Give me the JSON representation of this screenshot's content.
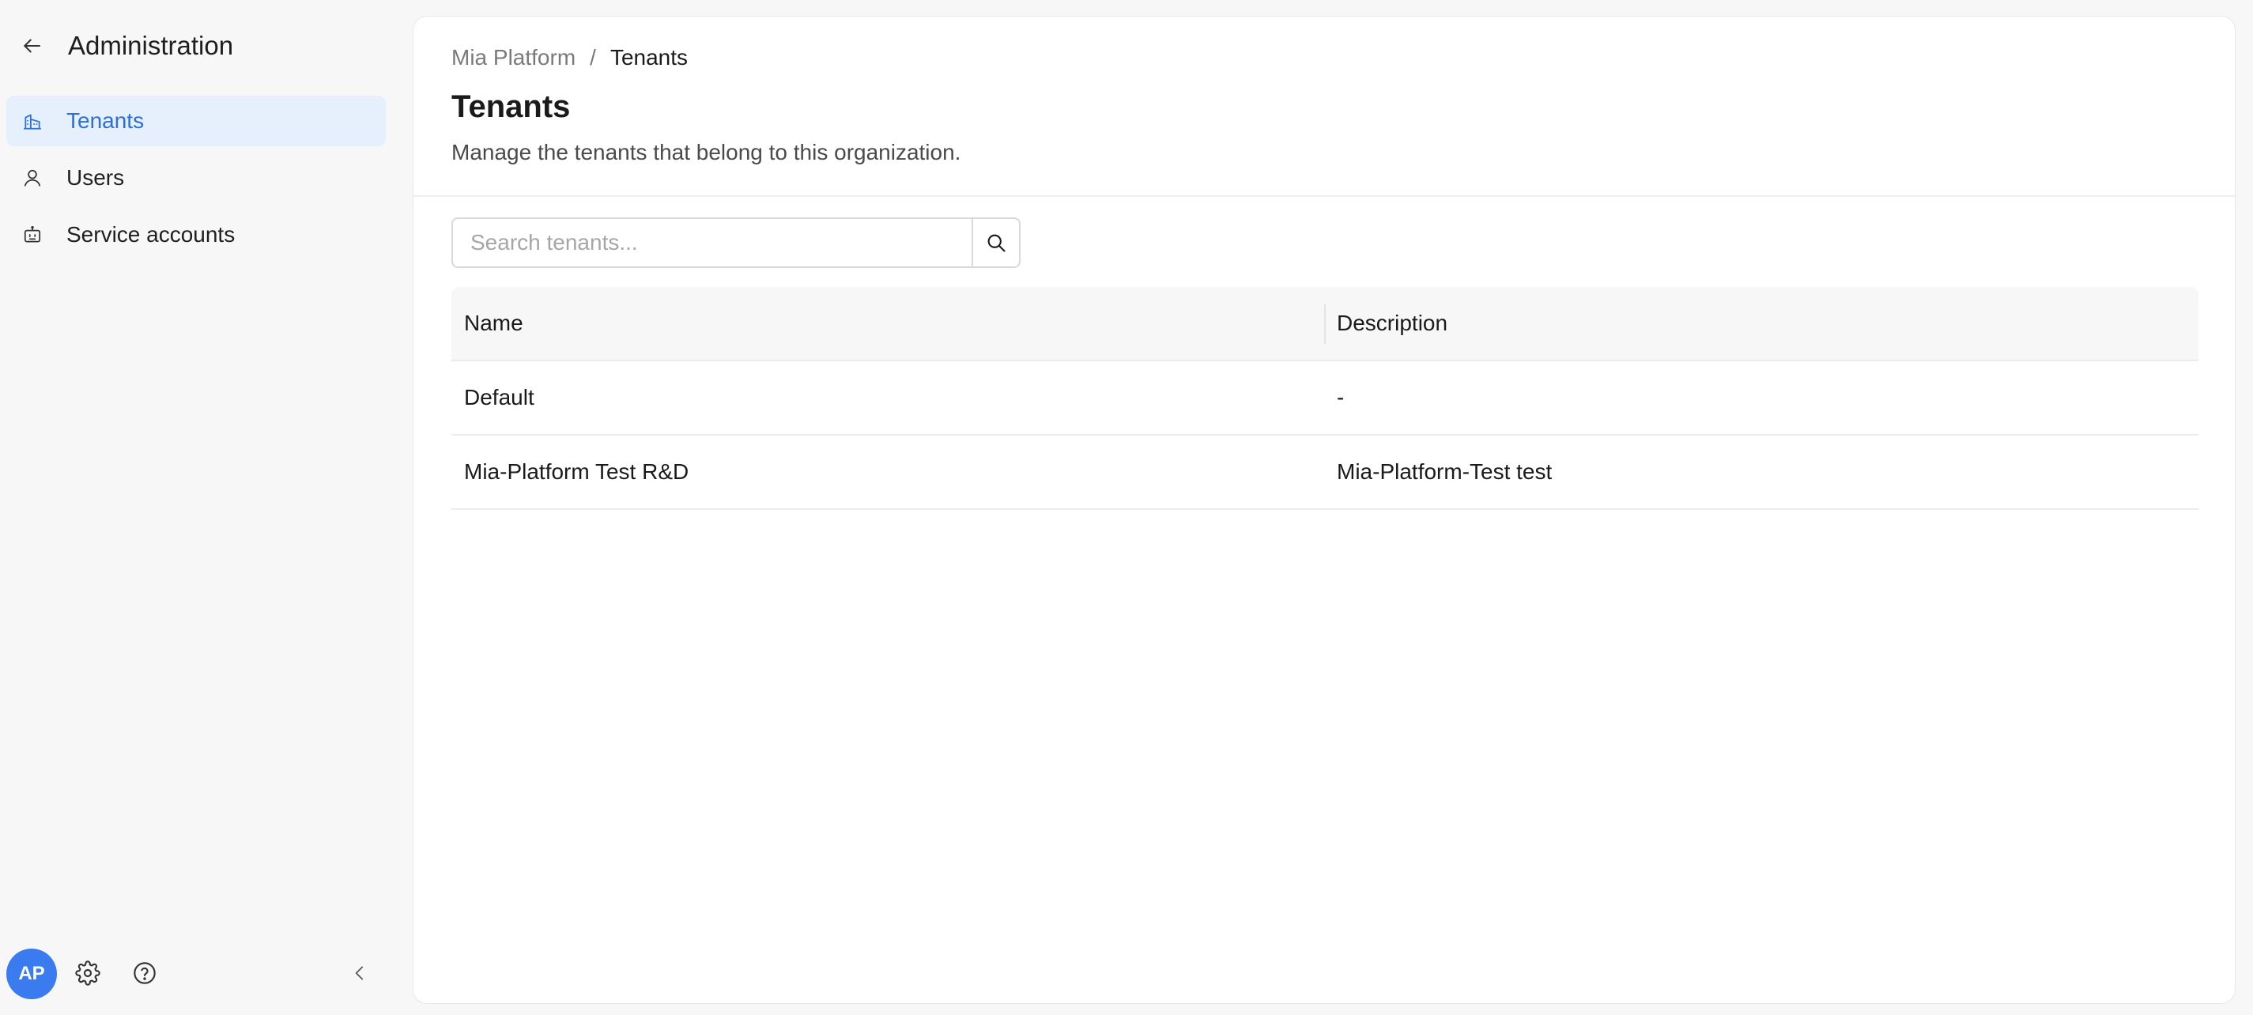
{
  "sidebar": {
    "title": "Administration",
    "items": [
      {
        "label": "Tenants",
        "icon": "building-icon",
        "active": true
      },
      {
        "label": "Users",
        "icon": "user-icon",
        "active": false
      },
      {
        "label": "Service accounts",
        "icon": "robot-icon",
        "active": false
      }
    ],
    "avatar_initials": "AP"
  },
  "breadcrumb": {
    "root": "Mia Platform",
    "separator": "/",
    "current": "Tenants"
  },
  "page": {
    "title": "Tenants",
    "description": "Manage the tenants that belong to this organization."
  },
  "search": {
    "placeholder": "Search tenants...",
    "value": ""
  },
  "table": {
    "headers": [
      "Name",
      "Description"
    ],
    "rows": [
      {
        "name": "Default",
        "description": "-"
      },
      {
        "name": "Mia-Platform Test R&D",
        "description": "Mia-Platform-Test test"
      }
    ]
  },
  "colors": {
    "accent": "#2c6fd9",
    "active_bg": "#e6f0fd",
    "avatar_bg": "#3a7bf0"
  }
}
